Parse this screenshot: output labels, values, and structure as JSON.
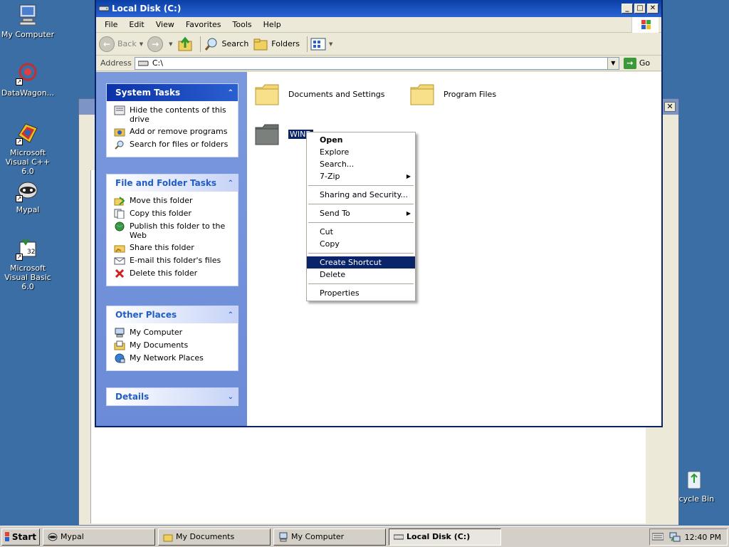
{
  "desktop": {
    "icons": [
      {
        "label": "My Computer",
        "icon": "my-computer-icon"
      },
      {
        "label": "DataWagon...",
        "icon": "datawagon-icon"
      },
      {
        "label": "Microsoft Visual C++ 6.0",
        "icon": "visual-cpp-icon"
      },
      {
        "label": "Mypal",
        "icon": "mypal-icon"
      },
      {
        "label": "Microsoft Visual Basic 6.0",
        "icon": "visual-basic-icon"
      },
      {
        "label": "ecycle Bin",
        "icon": "recycle-bin-icon"
      }
    ]
  },
  "window": {
    "title": "Local Disk (C:)",
    "menu": [
      "File",
      "Edit",
      "View",
      "Favorites",
      "Tools",
      "Help"
    ],
    "toolbar": {
      "back": "Back",
      "search": "Search",
      "folders": "Folders"
    },
    "address": {
      "label": "Address",
      "value": "C:\\",
      "go": "Go"
    }
  },
  "tasks": {
    "system": {
      "title": "System Tasks",
      "items": [
        "Hide the contents of this drive",
        "Add or remove programs",
        "Search for files or folders"
      ]
    },
    "file_folder": {
      "title": "File and Folder Tasks",
      "items": [
        "Move this folder",
        "Copy this folder",
        "Publish this folder to the Web",
        "Share this folder",
        "E-mail this folder's files",
        "Delete this folder"
      ]
    },
    "other": {
      "title": "Other Places",
      "items": [
        "My Computer",
        "My Documents",
        "My Network Places"
      ]
    },
    "details": {
      "title": "Details"
    }
  },
  "files": [
    {
      "name": "Documents and Settings"
    },
    {
      "name": "Program Files"
    },
    {
      "name": "WIND"
    }
  ],
  "context_menu": {
    "open": "Open",
    "explore": "Explore",
    "search": "Search...",
    "zip": "7-Zip",
    "sharing": "Sharing and Security...",
    "send_to": "Send To",
    "cut": "Cut",
    "copy": "Copy",
    "create_shortcut": "Create Shortcut",
    "delete": "Delete",
    "properties": "Properties"
  },
  "taskbar": {
    "start": "Start",
    "buttons": [
      "Mypal",
      "My Documents",
      "My Computer",
      "Local Disk (C:)"
    ],
    "clock": "12:40 PM"
  },
  "colors": {
    "desktop": "#3a6ea5",
    "titlebar": "#0a3fa6",
    "selection": "#0a246a"
  }
}
